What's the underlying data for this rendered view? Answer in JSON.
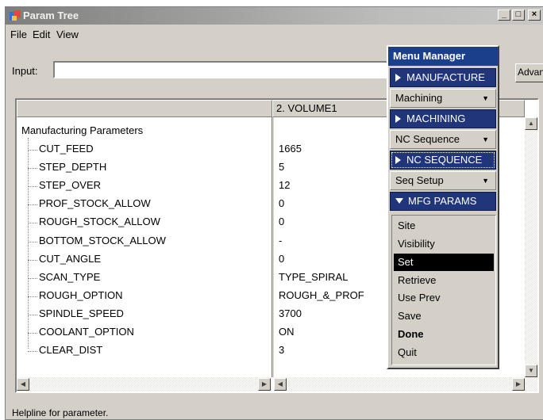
{
  "window": {
    "title": "Param Tree",
    "minimize_glyph": "_",
    "maximize_glyph": "□",
    "close_glyph": "×"
  },
  "menubar": [
    "File",
    "Edit",
    "View"
  ],
  "input": {
    "label": "Input:",
    "value": "",
    "advanced_label": "Advanced"
  },
  "table": {
    "columns": [
      "",
      "2. VOLUME1"
    ],
    "root_label": "Manufacturing Parameters",
    "rows": [
      {
        "name": "CUT_FEED",
        "value": "1665"
      },
      {
        "name": "STEP_DEPTH",
        "value": "5"
      },
      {
        "name": "STEP_OVER",
        "value": "12"
      },
      {
        "name": "PROF_STOCK_ALLOW",
        "value": "0"
      },
      {
        "name": "ROUGH_STOCK_ALLOW",
        "value": "0"
      },
      {
        "name": "BOTTOM_STOCK_ALLOW",
        "value": "-"
      },
      {
        "name": "CUT_ANGLE",
        "value": "0"
      },
      {
        "name": "SCAN_TYPE",
        "value": "TYPE_SPIRAL"
      },
      {
        "name": "ROUGH_OPTION",
        "value": "ROUGH_&_PROF"
      },
      {
        "name": "SPINDLE_SPEED",
        "value": "3700"
      },
      {
        "name": "COOLANT_OPTION",
        "value": "ON"
      },
      {
        "name": "CLEAR_DIST",
        "value": "3"
      }
    ]
  },
  "helpline": "Helpline for parameter.",
  "menu_manager": {
    "title": "Menu Manager",
    "sections": [
      {
        "header": "MANUFACTURE",
        "dropdown": "Machining"
      },
      {
        "header": "MACHINING",
        "dropdown": "NC Sequence"
      },
      {
        "header": "NC SEQUENCE",
        "dropdown": "Seq Setup"
      }
    ],
    "expanded_header": "MFG PARAMS",
    "items": [
      "Site",
      "Visibility",
      "Set",
      "Retrieve",
      "Use Prev",
      "Save",
      "Done",
      "Quit"
    ],
    "selected_item": "Set"
  }
}
